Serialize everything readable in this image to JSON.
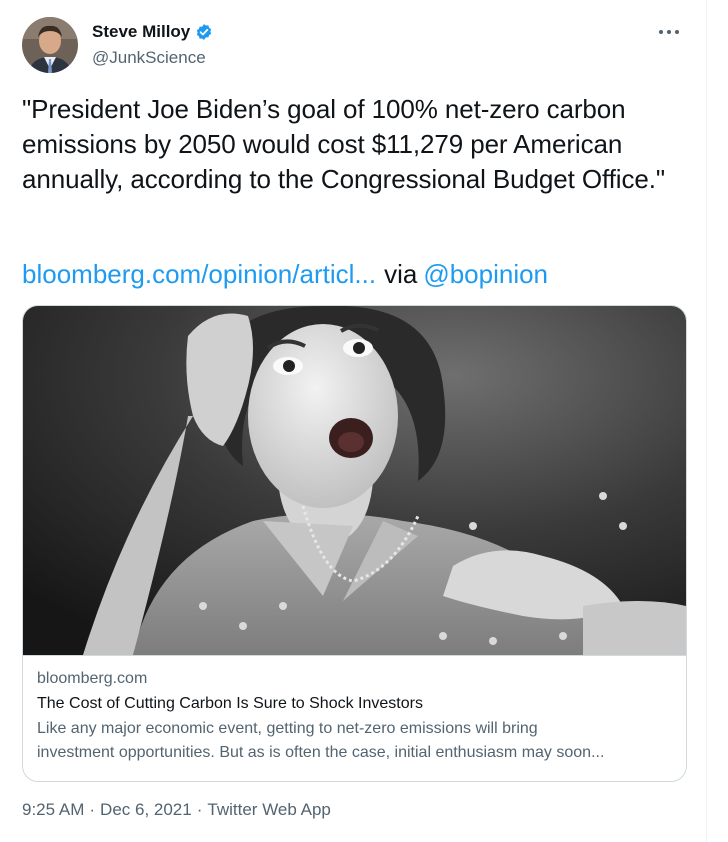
{
  "author": {
    "display_name": "Steve Milloy",
    "handle": "@JunkScience",
    "verified_icon": "verified-badge-icon",
    "avatar_icon": "profile-photo"
  },
  "tweet": {
    "text": "\"President Joe Biden’s goal of 100% net-zero carbon emissions by 2050 would cost $11,279 per American annually, according to the Congressional Budget Office.\"",
    "link_text": "bloomberg.com/opinion/articl...",
    "via_text": "via",
    "mention": "@bopinion"
  },
  "more_menu": {
    "icon": "more-options-icon",
    "label": "•••"
  },
  "card": {
    "image_icon": "surprised-woman-photo",
    "domain": "bloomberg.com",
    "title": "The Cost of Cutting Carbon Is Sure to Shock Investors",
    "description": "Like any major economic event, getting to net-zero emissions will bring\ninvestment opportunities. But as is often the case, initial enthusiasm may soon..."
  },
  "meta": {
    "time": "9:25 AM",
    "separator": "·",
    "date": "Dec 6, 2021",
    "source": "Twitter Web App"
  },
  "colors": {
    "link": "#1d9bf0",
    "text": "#0f1419",
    "secondary": "#536471",
    "border": "#cfd9de"
  }
}
